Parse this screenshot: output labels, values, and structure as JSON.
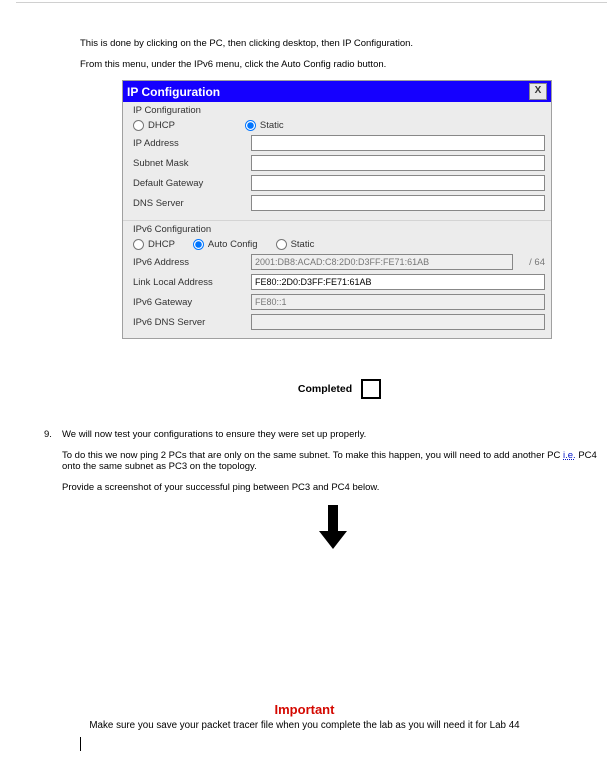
{
  "intro": {
    "line1": "This is done by clicking on the PC, then clicking desktop, then IP Configuration.",
    "line2": "From this menu, under the IPv6 menu, click the Auto Config radio button."
  },
  "ipconfig": {
    "window_title": "IP Configuration",
    "close_label": "X",
    "ipv4_section": "IP Configuration",
    "ipv4_radio_dhcp": "DHCP",
    "ipv4_radio_static": "Static",
    "lbl_ip": "IP Address",
    "lbl_subnet": "Subnet Mask",
    "lbl_gw": "Default Gateway",
    "lbl_dns": "DNS Server",
    "val_ip": "",
    "val_subnet": "",
    "val_gw": "",
    "val_dns": "",
    "ipv6_section": "IPv6 Configuration",
    "ipv6_radio_dhcp": "DHCP",
    "ipv6_radio_auto": "Auto Config",
    "ipv6_radio_static": "Static",
    "lbl_ipv6": "IPv6 Address",
    "val_ipv6": "2001:DB8:ACAD:C8:2D0:D3FF:FE71:61AB",
    "prefix_suffix": "/ 64",
    "lbl_linklocal": "Link Local Address",
    "val_linklocal": "FE80::2D0:D3FF:FE71:61AB",
    "lbl_ipv6gw": "IPv6 Gateway",
    "val_ipv6gw": "FE80::1",
    "lbl_ipv6dns": "IPv6 DNS Server",
    "val_ipv6dns": ""
  },
  "completed_label": "Completed",
  "step9": {
    "number": "9.",
    "line1": "We will now test your configurations to ensure they were set up properly.",
    "line2a": "To do this we now ping 2 PCs that are only on the same subnet. To make this happen, you will need to add another PC ",
    "ie": "i.e.",
    "line2b": " PC4 onto the same subnet as PC3 on the topology.",
    "line3": "Provide a screenshot of your successful ping between PC3 and PC4 below."
  },
  "important": {
    "title": "Important",
    "text": "Make sure you save your packet tracer file when you complete the lab as you will need it for Lab 44"
  }
}
